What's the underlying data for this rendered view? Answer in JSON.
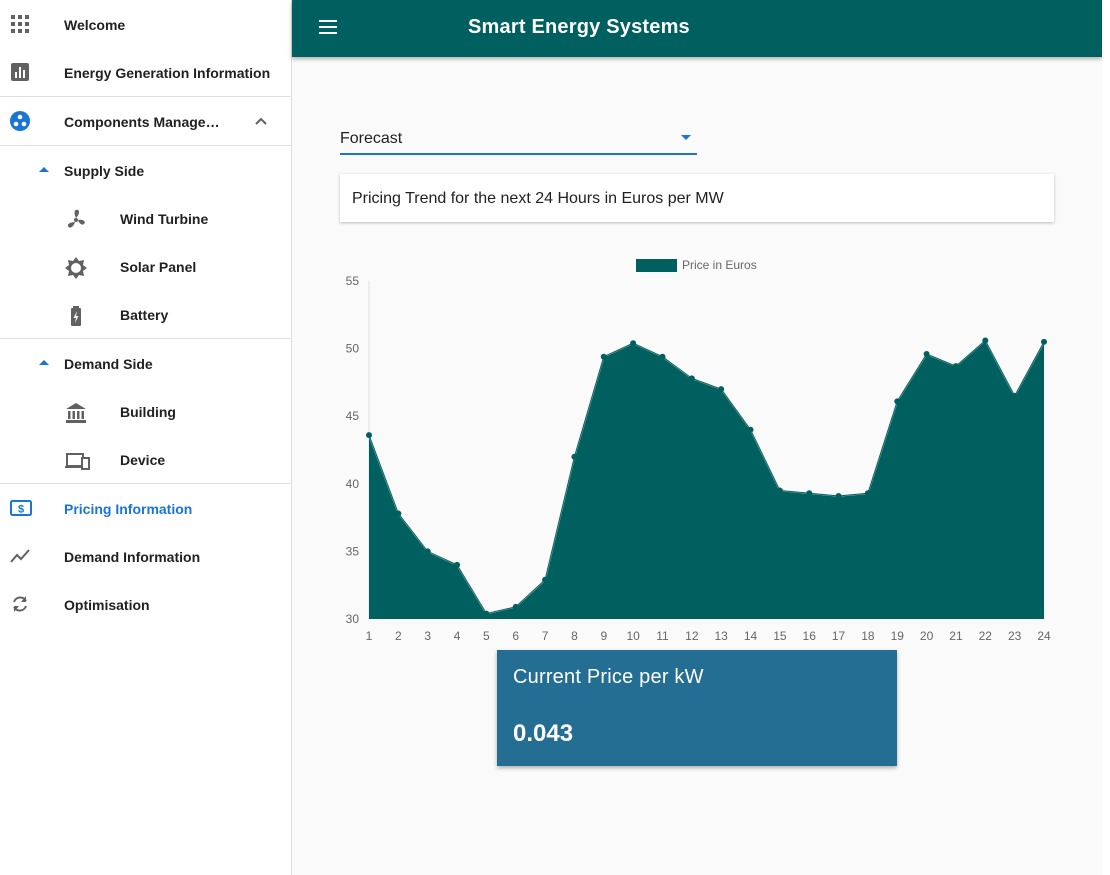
{
  "sidebar": {
    "items": [
      {
        "label": "Welcome",
        "icon": "apps-grid-icon"
      },
      {
        "label": "Energy Generation Information",
        "icon": "bar-chart-icon"
      },
      {
        "label": "Components Manage…",
        "icon": "components-icon",
        "expanded": true
      },
      {
        "label": "Supply Side",
        "icon": "arrow-up-icon"
      },
      {
        "label": "Wind Turbine",
        "icon": "fan-icon"
      },
      {
        "label": "Solar Panel",
        "icon": "sun-icon"
      },
      {
        "label": "Battery",
        "icon": "battery-charging-icon"
      },
      {
        "label": "Demand Side",
        "icon": "arrow-up-icon"
      },
      {
        "label": "Building",
        "icon": "bank-icon"
      },
      {
        "label": "Device",
        "icon": "devices-icon"
      },
      {
        "label": "Pricing Information",
        "icon": "dollar-card-icon",
        "active": true
      },
      {
        "label": "Demand Information",
        "icon": "trending-icon"
      },
      {
        "label": "Optimisation",
        "icon": "refresh-icon"
      }
    ]
  },
  "appbar": {
    "title": "Smart Energy Systems"
  },
  "forecast_select": {
    "value": "Forecast"
  },
  "card": {
    "title": "Pricing Trend for the next 24 Hours in Euros per MW"
  },
  "price_card": {
    "label": "Current Price per kW",
    "value": "0.043"
  },
  "colors": {
    "primary": "#00605f",
    "accent": "#1976d2",
    "price_card": "#236e92"
  },
  "chart_data": {
    "type": "area",
    "x": [
      1,
      2,
      3,
      4,
      5,
      6,
      7,
      8,
      9,
      10,
      11,
      12,
      13,
      14,
      15,
      16,
      17,
      18,
      19,
      20,
      21,
      22,
      23,
      24
    ],
    "series": [
      {
        "name": "Price in Euros",
        "values": [
          43.6,
          37.8,
          35.0,
          34.0,
          30.4,
          30.9,
          32.9,
          42.0,
          49.4,
          50.4,
          49.4,
          47.8,
          47.0,
          44.0,
          39.5,
          39.3,
          39.1,
          39.3,
          46.1,
          49.6,
          48.7,
          50.6,
          46.5,
          50.5
        ]
      }
    ],
    "ylim": [
      30,
      55
    ],
    "yticks": [
      30,
      35,
      40,
      45,
      50,
      55
    ],
    "legend": "top",
    "grid": false
  }
}
